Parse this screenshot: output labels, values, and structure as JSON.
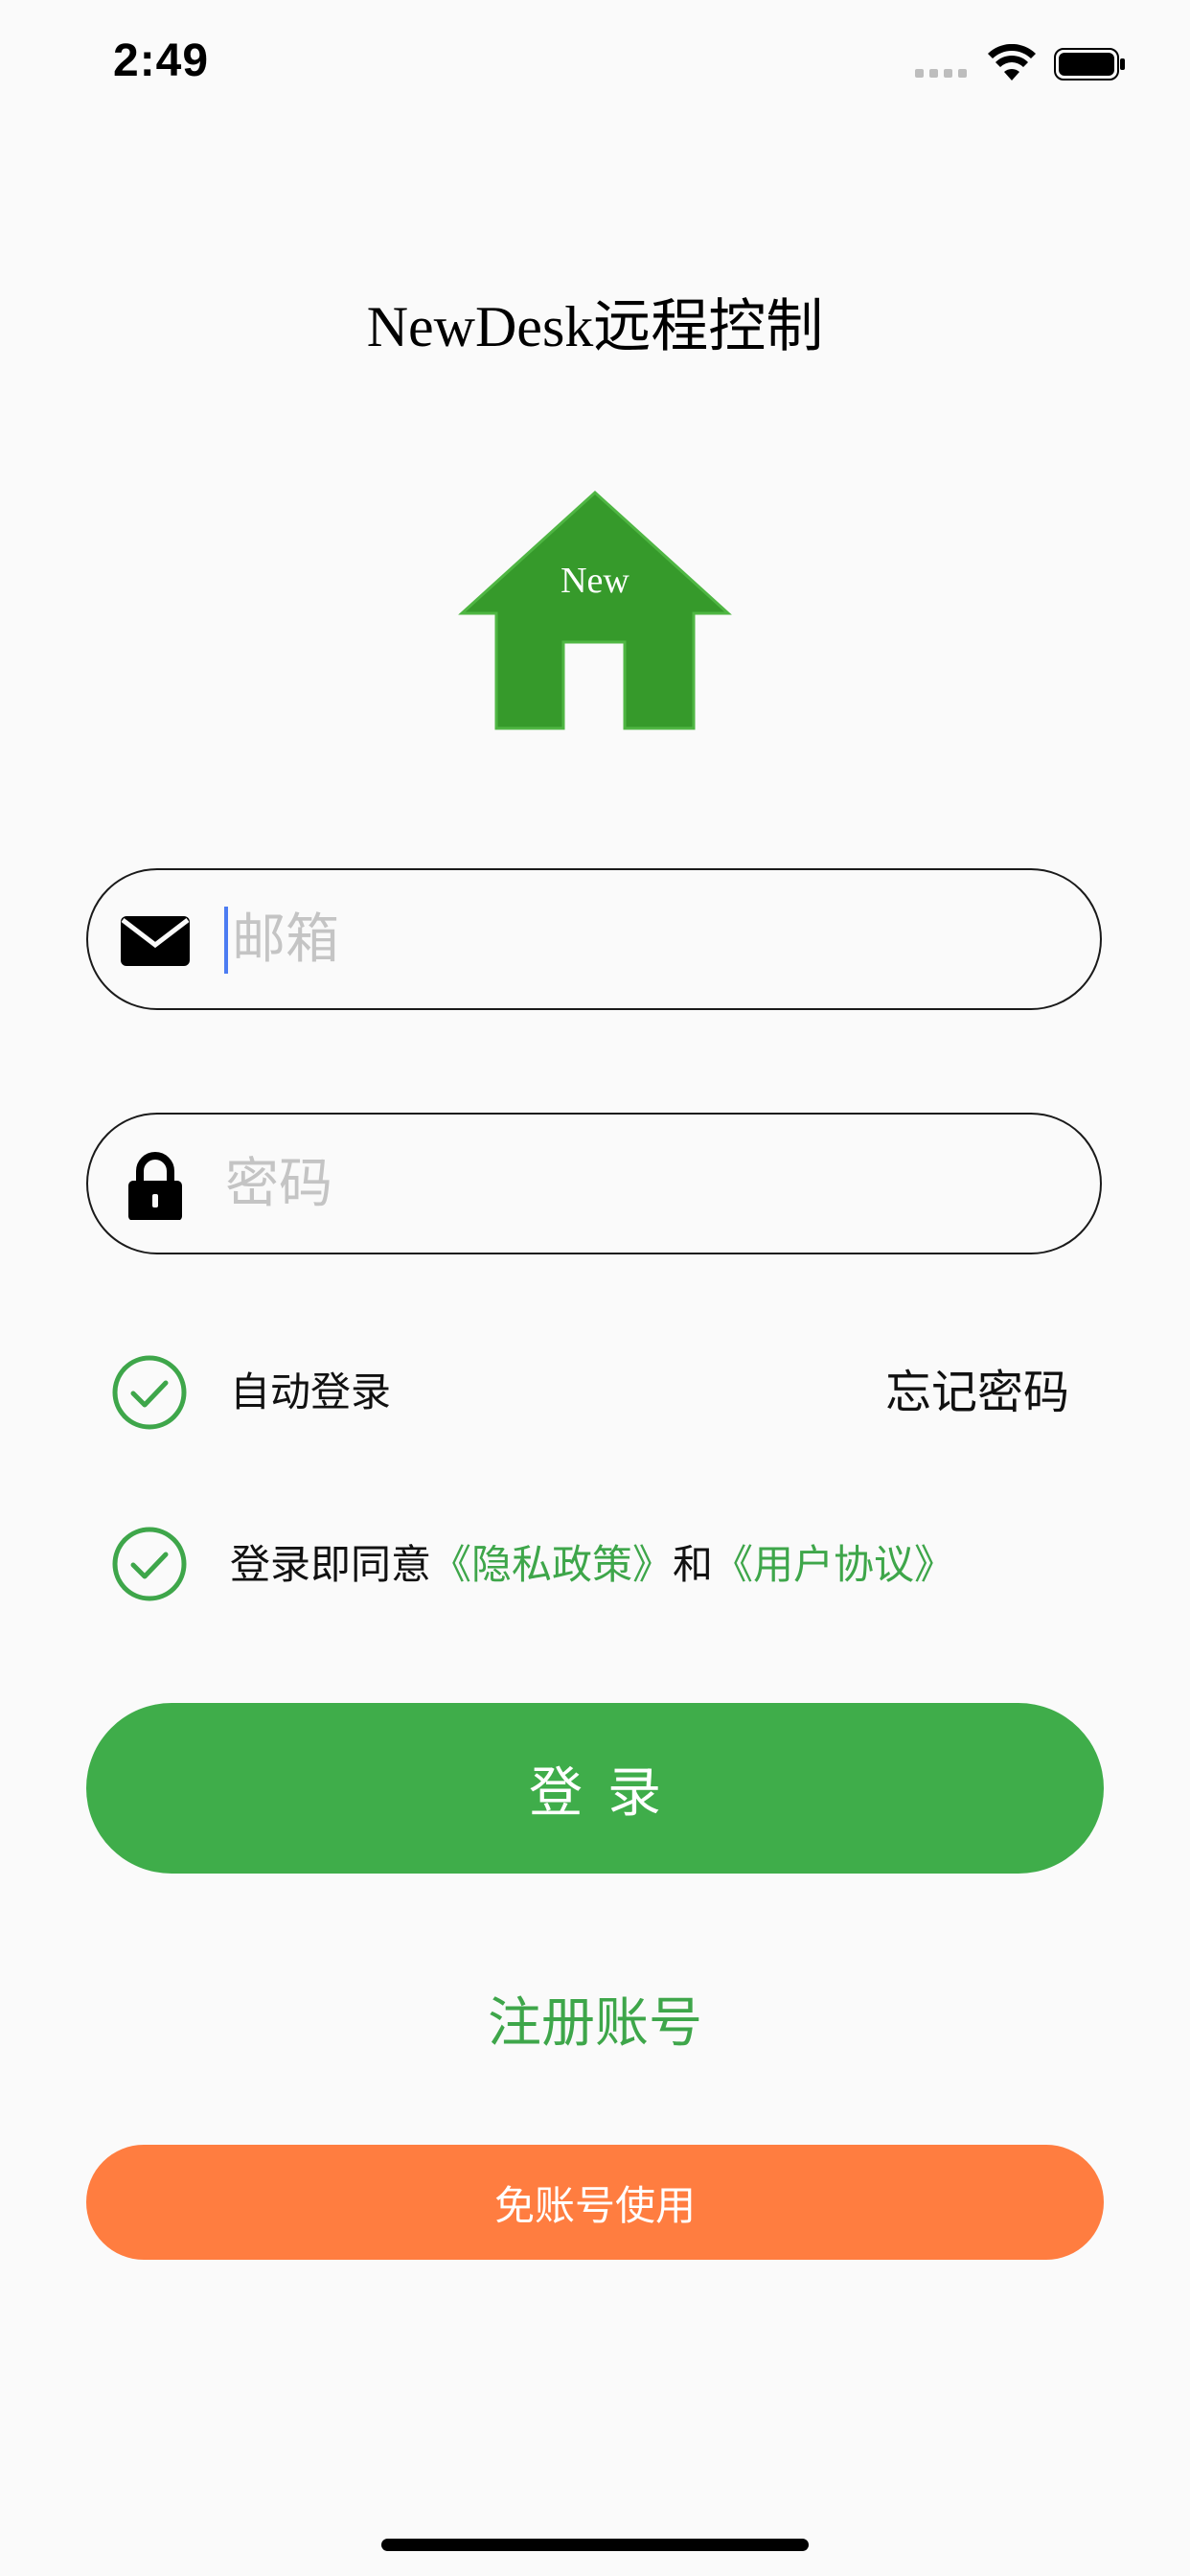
{
  "status_bar": {
    "time": "2:49"
  },
  "app": {
    "title": "NewDesk远程控制",
    "logo_text": "New",
    "logo_color": "#369a2b"
  },
  "email_field": {
    "placeholder": "邮箱",
    "icon": "envelope-icon",
    "focused": true
  },
  "password_field": {
    "placeholder": "密码",
    "icon": "lock-icon"
  },
  "options": {
    "auto_login_label": "自动登录",
    "auto_login_checked": true,
    "forgot_password_label": "忘记密码"
  },
  "agreement": {
    "checked": true,
    "prefix": "登录即同意",
    "privacy_link": "《隐私政策》",
    "conjunction": "和",
    "terms_link": "《用户协议》"
  },
  "buttons": {
    "login_label": "登录",
    "register_label": "注册账号",
    "guest_label": "免账号使用"
  },
  "colors": {
    "accent_green": "#3fad4a",
    "accent_orange": "#ff7d40"
  }
}
